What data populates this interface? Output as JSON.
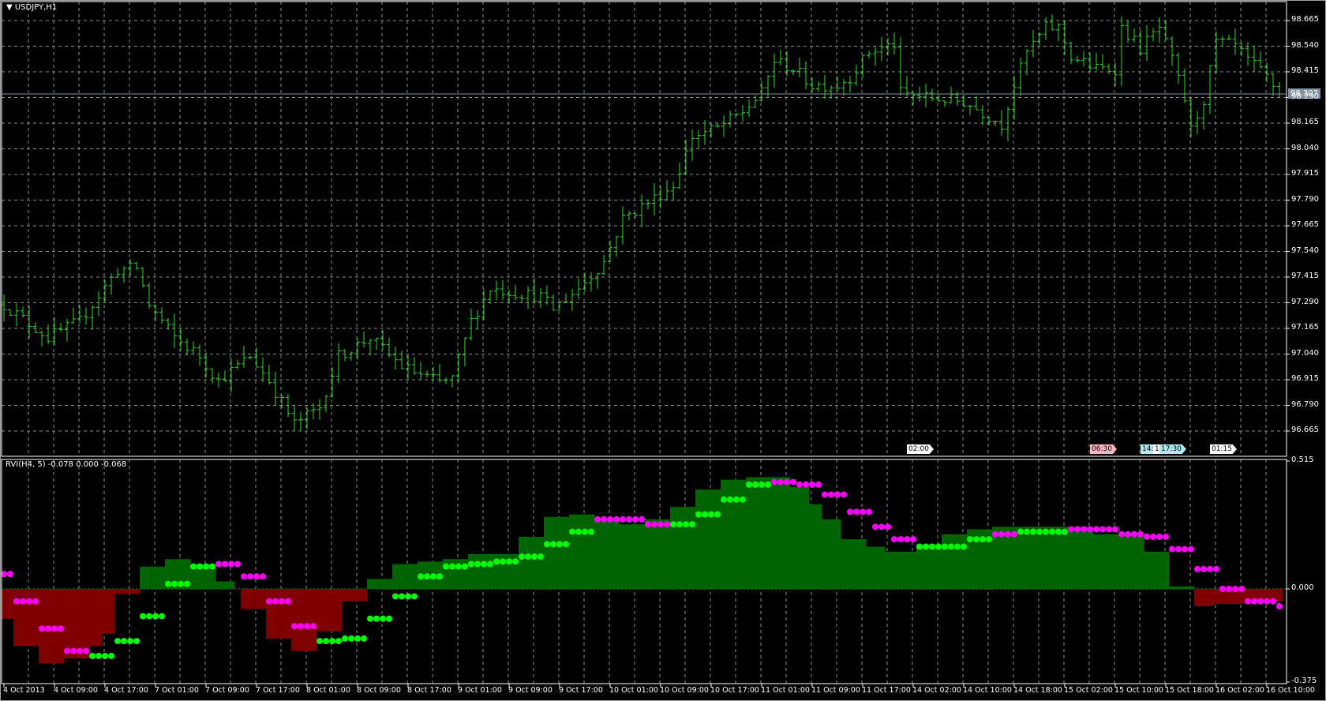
{
  "chart": {
    "title": "USDJPY,H1",
    "menu_icon": "triangle-down-icon",
    "current_price": "98.307",
    "bar_color": "#22dd22",
    "price_labels": [
      "98.665",
      "98.540",
      "98.415",
      "98.290",
      "98.165",
      "98.040",
      "97.915",
      "97.790",
      "97.665",
      "97.540",
      "97.415",
      "97.290",
      "97.165",
      "97.040",
      "96.915",
      "96.790",
      "96.665"
    ],
    "time_labels": [
      "4 Oct 2013",
      "4 Oct 09:00",
      "4 Oct 17:00",
      "7 Oct 01:00",
      "7 Oct 09:00",
      "7 Oct 17:00",
      "8 Oct 01:00",
      "8 Oct 09:00",
      "8 Oct 17:00",
      "9 Oct 01:00",
      "9 Oct 09:00",
      "9 Oct 17:00",
      "10 Oct 01:00",
      "10 Oct 09:00",
      "10 Oct 17:00",
      "11 Oct 01:00",
      "11 Oct 09:00",
      "11 Oct 17:00",
      "14 Oct 02:00",
      "14 Oct 10:00",
      "14 Oct 18:00",
      "15 Oct 02:00",
      "15 Oct 10:00",
      "15 Oct 18:00",
      "16 Oct 02:00",
      "16 Oct 10:00"
    ],
    "event_tags": [
      {
        "label": "02:00",
        "bar": 143,
        "color": "#ffffff"
      },
      {
        "label": "06:30",
        "bar": 172,
        "color": "#ffb6c1"
      },
      {
        "label": "14:",
        "bar": 180,
        "color": "#b0e8f0"
      },
      {
        "label": "1",
        "bar": 182,
        "color": "#ffffff"
      },
      {
        "label": "17:30",
        "bar": 183,
        "color": "#b0e8f0"
      },
      {
        "label": "01:15",
        "bar": 191,
        "color": "#ffffff"
      }
    ]
  },
  "indicator": {
    "title": "RVI(H4, 5) -0.078 0.000 -0.068",
    "scale_labels": [
      "0.515",
      "0.000",
      "-0.375"
    ],
    "up_color": "#006400",
    "down_color": "#800000",
    "signal_up_color": "#00ff00",
    "signal_down_color": "#ff00ff"
  },
  "chart_data": {
    "type": "ohlc+indicator",
    "symbol": "USDJPY",
    "timeframe": "H1",
    "bars": 203,
    "ylim": [
      96.62,
      98.757
    ],
    "close_keypoints": [
      [
        0,
        97.28
      ],
      [
        7,
        97.12
      ],
      [
        12,
        97.2
      ],
      [
        18,
        97.45
      ],
      [
        21,
        97.46
      ],
      [
        23,
        97.28
      ],
      [
        27,
        97.12
      ],
      [
        31,
        97.03
      ],
      [
        34,
        96.91
      ],
      [
        39,
        97.03
      ],
      [
        42,
        96.91
      ],
      [
        46,
        96.7
      ],
      [
        50,
        96.78
      ],
      [
        53,
        97.03
      ],
      [
        58,
        97.12
      ],
      [
        63,
        96.98
      ],
      [
        69,
        96.9
      ],
      [
        71,
        96.92
      ],
      [
        74,
        97.2
      ],
      [
        77,
        97.36
      ],
      [
        85,
        97.32
      ],
      [
        87,
        97.26
      ],
      [
        91,
        97.36
      ],
      [
        95,
        97.49
      ],
      [
        98,
        97.7
      ],
      [
        102,
        97.78
      ],
      [
        106,
        97.86
      ],
      [
        109,
        98.1
      ],
      [
        113,
        98.14
      ],
      [
        117,
        98.22
      ],
      [
        120,
        98.31
      ],
      [
        122,
        98.47
      ],
      [
        125,
        98.43
      ],
      [
        128,
        98.35
      ],
      [
        132,
        98.35
      ],
      [
        134,
        98.39
      ],
      [
        137,
        98.51
      ],
      [
        141,
        98.55
      ],
      [
        142,
        98.31
      ],
      [
        146,
        98.29
      ],
      [
        152,
        98.27
      ],
      [
        156,
        98.2
      ],
      [
        158,
        98.16
      ],
      [
        160,
        98.35
      ],
      [
        162,
        98.51
      ],
      [
        165,
        98.63
      ],
      [
        167,
        98.63
      ],
      [
        169,
        98.49
      ],
      [
        173,
        98.43
      ],
      [
        176,
        98.43
      ],
      [
        177,
        98.63
      ],
      [
        180,
        98.53
      ],
      [
        183,
        98.63
      ],
      [
        185,
        98.47
      ],
      [
        187,
        98.28
      ],
      [
        188,
        98.13
      ],
      [
        190,
        98.28
      ],
      [
        192,
        98.56
      ],
      [
        195,
        98.54
      ],
      [
        197,
        98.47
      ],
      [
        200,
        98.39
      ],
      [
        202,
        98.307
      ]
    ],
    "rvi_histogram_steps": [
      [
        0,
        -0.12
      ],
      [
        2,
        -0.23
      ],
      [
        6,
        -0.3
      ],
      [
        10,
        -0.28
      ],
      [
        14,
        -0.23
      ],
      [
        16,
        -0.18
      ],
      [
        18,
        -0.02
      ],
      [
        22,
        0.09
      ],
      [
        26,
        0.12
      ],
      [
        30,
        0.1
      ],
      [
        34,
        0.03
      ],
      [
        37,
        0.0
      ],
      [
        38,
        -0.08
      ],
      [
        42,
        -0.2
      ],
      [
        46,
        -0.25
      ],
      [
        50,
        -0.17
      ],
      [
        54,
        -0.05
      ],
      [
        58,
        0.04
      ],
      [
        62,
        0.1
      ],
      [
        66,
        0.11
      ],
      [
        70,
        0.12
      ],
      [
        74,
        0.14
      ],
      [
        82,
        0.21
      ],
      [
        86,
        0.29
      ],
      [
        90,
        0.3
      ],
      [
        94,
        0.28
      ],
      [
        98,
        0.26
      ],
      [
        102,
        0.28
      ],
      [
        106,
        0.33
      ],
      [
        110,
        0.4
      ],
      [
        114,
        0.44
      ],
      [
        118,
        0.45
      ],
      [
        125,
        0.41
      ],
      [
        128,
        0.34
      ],
      [
        130,
        0.28
      ],
      [
        133,
        0.2
      ],
      [
        137,
        0.17
      ],
      [
        140,
        0.15
      ],
      [
        145,
        0.18
      ],
      [
        149,
        0.22
      ],
      [
        153,
        0.24
      ],
      [
        157,
        0.25
      ],
      [
        173,
        0.22
      ],
      [
        181,
        0.15
      ],
      [
        185,
        0.01
      ],
      [
        189,
        -0.07
      ],
      [
        192,
        -0.06
      ],
      [
        197,
        -0.05
      ]
    ],
    "rvi_signal_steps": [
      [
        0,
        0.06,
        "d"
      ],
      [
        2,
        -0.05,
        "d"
      ],
      [
        6,
        -0.16,
        "d"
      ],
      [
        10,
        -0.25,
        "d"
      ],
      [
        14,
        -0.27,
        "u"
      ],
      [
        18,
        -0.21,
        "u"
      ],
      [
        22,
        -0.11,
        "u"
      ],
      [
        26,
        0.02,
        "u"
      ],
      [
        30,
        0.09,
        "u"
      ],
      [
        34,
        0.1,
        "d"
      ],
      [
        38,
        0.05,
        "d"
      ],
      [
        42,
        -0.05,
        "d"
      ],
      [
        46,
        -0.15,
        "d"
      ],
      [
        50,
        -0.21,
        "u"
      ],
      [
        54,
        -0.2,
        "u"
      ],
      [
        58,
        -0.12,
        "u"
      ],
      [
        62,
        -0.03,
        "u"
      ],
      [
        66,
        0.05,
        "u"
      ],
      [
        70,
        0.09,
        "u"
      ],
      [
        74,
        0.1,
        "u"
      ],
      [
        78,
        0.11,
        "u"
      ],
      [
        82,
        0.13,
        "u"
      ],
      [
        86,
        0.18,
        "u"
      ],
      [
        90,
        0.23,
        "u"
      ],
      [
        94,
        0.28,
        "d"
      ],
      [
        102,
        0.26,
        "d"
      ],
      [
        106,
        0.26,
        "u"
      ],
      [
        110,
        0.3,
        "u"
      ],
      [
        114,
        0.36,
        "u"
      ],
      [
        118,
        0.42,
        "u"
      ],
      [
        122,
        0.43,
        "d"
      ],
      [
        126,
        0.42,
        "d"
      ],
      [
        130,
        0.38,
        "d"
      ],
      [
        134,
        0.31,
        "d"
      ],
      [
        138,
        0.25,
        "d"
      ],
      [
        141,
        0.2,
        "d"
      ],
      [
        145,
        0.17,
        "u"
      ],
      [
        153,
        0.2,
        "u"
      ],
      [
        157,
        0.22,
        "d"
      ],
      [
        161,
        0.23,
        "u"
      ],
      [
        169,
        0.24,
        "d"
      ],
      [
        177,
        0.22,
        "d"
      ],
      [
        181,
        0.21,
        "d"
      ],
      [
        185,
        0.16,
        "d"
      ],
      [
        189,
        0.08,
        "d"
      ],
      [
        193,
        0.0,
        "d"
      ],
      [
        197,
        -0.05,
        "d"
      ],
      [
        202,
        -0.07,
        "d"
      ]
    ],
    "indicator_ylim": [
      -0.375,
      0.515
    ]
  }
}
